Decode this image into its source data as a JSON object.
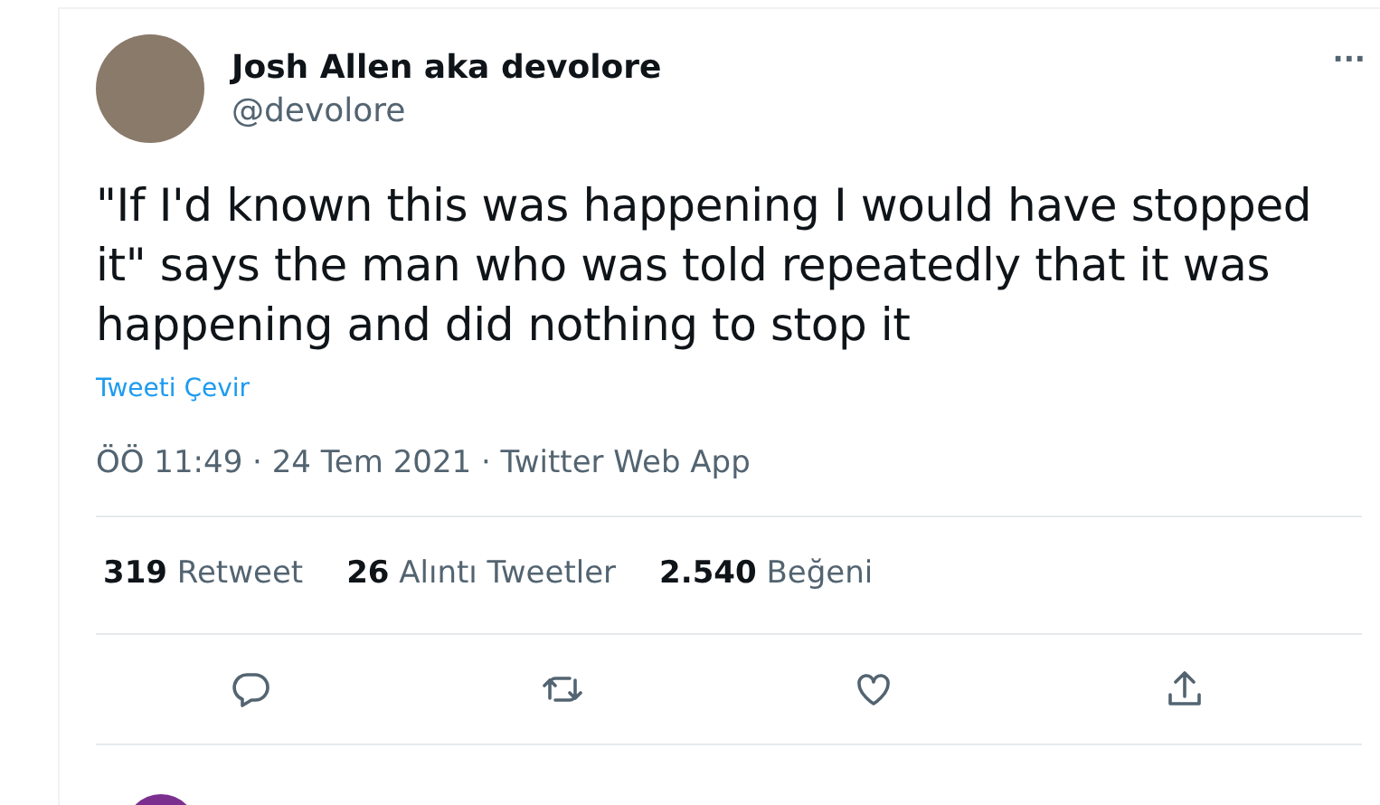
{
  "tweet": {
    "author_name": "Josh Allen aka devolore",
    "handle": "@devolore",
    "more": "···",
    "text": "\"If I'd known this was happening I would have stopped it\" says the man who was told repeatedly that it was happening and did nothing to stop it",
    "translate": "Tweeti Çevir",
    "meta": "ÖÖ 11:49 · 24 Tem 2021 · Twitter Web App"
  },
  "stats": [
    {
      "count": "319",
      "label": "Retweet"
    },
    {
      "count": "26",
      "label": "Alıntı Tweetler"
    },
    {
      "count": "2.540",
      "label": "Beğeni"
    }
  ],
  "actions": [
    {
      "kind": "reply"
    },
    {
      "kind": "retweet"
    },
    {
      "kind": "like"
    },
    {
      "kind": "share"
    }
  ]
}
